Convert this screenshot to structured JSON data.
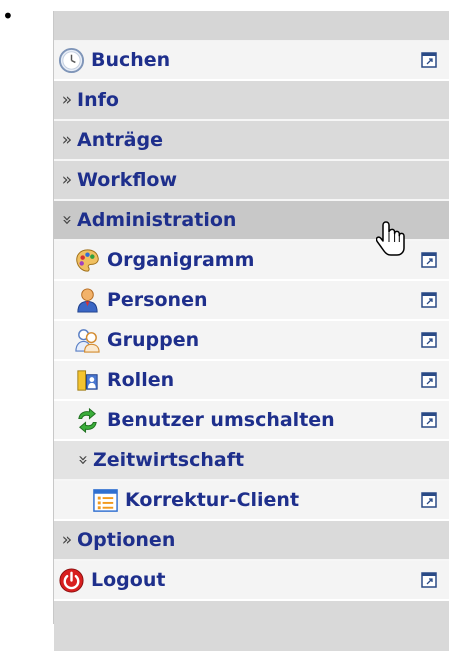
{
  "bullet": "•",
  "menu": {
    "items": [
      {
        "label": "Buchen",
        "icon": "clock-icon"
      },
      {
        "label": "Info",
        "icon": "chevron-double-right-icon"
      },
      {
        "label": "Anträge",
        "icon": "chevron-double-right-icon"
      },
      {
        "label": "Workflow",
        "icon": "chevron-double-right-icon"
      },
      {
        "label": "Administration",
        "icon": "chevron-double-down-icon"
      },
      {
        "label": "Organigramm",
        "icon": "palette-icon"
      },
      {
        "label": "Personen",
        "icon": "person-icon"
      },
      {
        "label": "Gruppen",
        "icon": "group-icon"
      },
      {
        "label": "Rollen",
        "icon": "roles-icon"
      },
      {
        "label": "Benutzer umschalten",
        "icon": "switch-user-icon"
      },
      {
        "label": "Zeitwirtschaft",
        "icon": "chevron-double-down-icon"
      },
      {
        "label": "Korrektur-Client",
        "icon": "list-window-icon"
      },
      {
        "label": "Optionen",
        "icon": "chevron-double-right-icon"
      },
      {
        "label": "Logout",
        "icon": "power-icon"
      }
    ],
    "chevron_right": "»",
    "chevron_down": "≫"
  },
  "colors": {
    "link_text": "#1e2f8c",
    "item_bg": "#f4f4f4",
    "section_bg": "#dadada",
    "open_section_bg": "#c8c8c8"
  }
}
